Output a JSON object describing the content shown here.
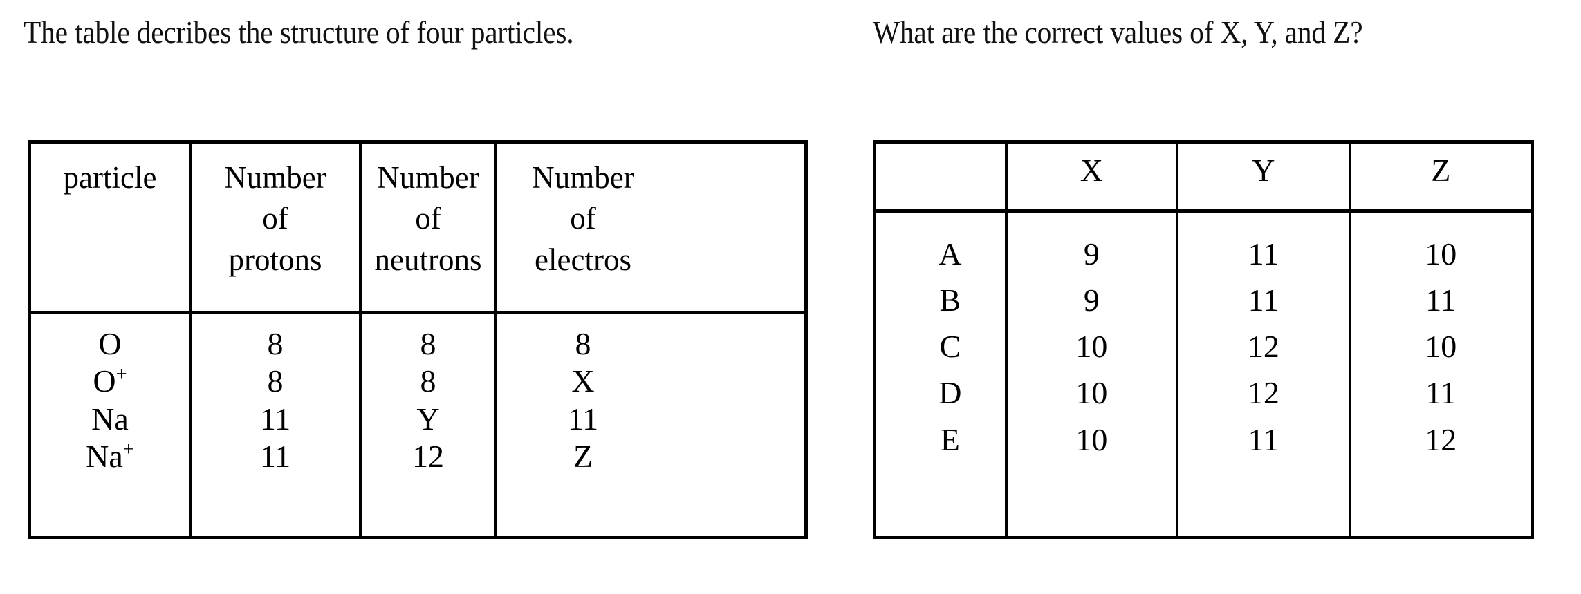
{
  "prompts": {
    "left": "The table decribes the structure of four particles.",
    "right": "What are the correct values of X, Y, and Z?"
  },
  "particle_table": {
    "headers": [
      {
        "lines": [
          "particle"
        ]
      },
      {
        "lines": [
          "Number",
          "of",
          "protons"
        ]
      },
      {
        "lines": [
          "Number",
          "of",
          "neutrons"
        ]
      },
      {
        "lines": [
          "Number",
          "of",
          "electros"
        ]
      }
    ],
    "columns": {
      "particle": [
        "O",
        "O",
        "Na",
        "Na"
      ],
      "particle_charge": [
        "",
        "+",
        "",
        "+"
      ],
      "protons": [
        "8",
        "8",
        "11",
        "11"
      ],
      "neutrons": [
        "8",
        "8",
        "Y",
        "12"
      ],
      "electrons": [
        "8",
        "X",
        "11",
        "Z"
      ]
    },
    "rows": [
      {
        "particle": "O",
        "charge": "",
        "protons": "8",
        "neutrons": "8",
        "electrons": "8"
      },
      {
        "particle": "O",
        "charge": "+",
        "protons": "8",
        "neutrons": "8",
        "electrons": "X"
      },
      {
        "particle": "Na",
        "charge": "",
        "protons": "11",
        "neutrons": "Y",
        "electrons": "11"
      },
      {
        "particle": "Na",
        "charge": "+",
        "protons": "11",
        "neutrons": "12",
        "electrons": "Z"
      }
    ]
  },
  "options_table": {
    "headers": [
      "",
      "X",
      "Y",
      "Z"
    ],
    "columns": {
      "option": [
        "A",
        "B",
        "C",
        "D",
        "E"
      ],
      "X": [
        "9",
        "9",
        "10",
        "10",
        "10"
      ],
      "Y": [
        "11",
        "11",
        "12",
        "12",
        "11"
      ],
      "Z": [
        "10",
        "11",
        "10",
        "11",
        "12"
      ]
    },
    "rows": [
      {
        "option": "A",
        "X": "9",
        "Y": "11",
        "Z": "10"
      },
      {
        "option": "B",
        "X": "9",
        "Y": "11",
        "Z": "11"
      },
      {
        "option": "C",
        "X": "10",
        "Y": "12",
        "Z": "10"
      },
      {
        "option": "D",
        "X": "10",
        "Y": "12",
        "Z": "11"
      },
      {
        "option": "E",
        "X": "10",
        "Y": "11",
        "Z": "12"
      }
    ]
  },
  "colors": {
    "background": "#ffffff",
    "text": "#000000",
    "border": "#000000"
  }
}
